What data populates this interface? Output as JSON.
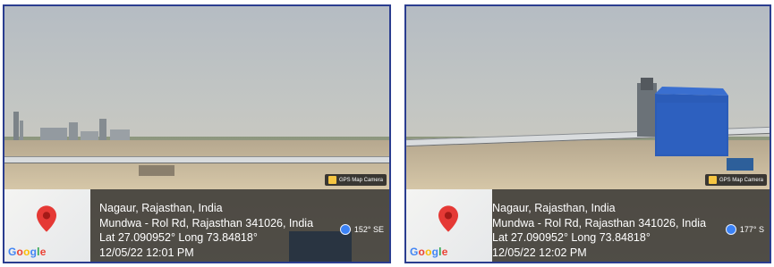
{
  "photos": [
    {
      "badge": "GPS Map Camera",
      "location_title": "Nagaur, Rajasthan, India",
      "address": "Mundwa - Rol Rd, Rajasthan 341026, India",
      "coords": "Lat 27.090952° Long 73.84818°",
      "datetime": "12/05/22 12:01 PM",
      "heading": "152° SE"
    },
    {
      "badge": "GPS Map Camera",
      "location_title": "Nagaur, Rajasthan, India",
      "address": "Mundwa - Rol Rd, Rajasthan 341026, India",
      "coords": "Lat 27.090952° Long 73.84818°",
      "datetime": "12/05/22 12:02 PM",
      "heading": "177° S"
    }
  ],
  "map": {
    "brand": "Google"
  },
  "colors": {
    "frame": "#2a3d8f",
    "overlay": "#282828",
    "pin": "#e53935",
    "compass": "#3b82f6"
  }
}
